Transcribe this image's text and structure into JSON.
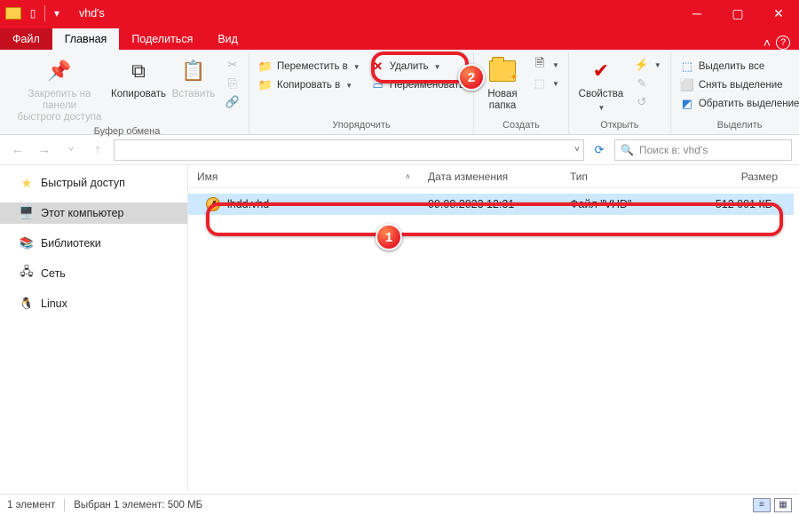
{
  "window": {
    "title": "vhd's"
  },
  "tabs": {
    "file": "Файл",
    "home": "Главная",
    "share": "Поделиться",
    "view": "Вид"
  },
  "ribbon": {
    "clipboard": {
      "label": "Буфер обмена",
      "pin": "Закрепить на панели\nбыстрого доступа",
      "copy": "Копировать",
      "paste": "Вставить"
    },
    "organize": {
      "label": "Упорядочить",
      "move_to": "Переместить в",
      "copy_to": "Копировать в",
      "delete": "Удалить",
      "rename": "Переименовать"
    },
    "new": {
      "label": "Создать",
      "new_folder": "Новая\nпапка"
    },
    "open": {
      "label": "Открыть",
      "properties": "Свойства"
    },
    "select": {
      "label": "Выделить",
      "select_all": "Выделить все",
      "select_none": "Снять выделение",
      "invert": "Обратить выделение"
    }
  },
  "address": {
    "search_placeholder": "Поиск в: vhd's"
  },
  "nav": {
    "quick": "Быстрый доступ",
    "thispc": "Этот компьютер",
    "libraries": "Библиотеки",
    "network": "Сеть",
    "linux": "Linux"
  },
  "columns": {
    "name": "Имя",
    "date": "Дата изменения",
    "type": "Тип",
    "size": "Размер"
  },
  "files": [
    {
      "name": "lhdd.vhd",
      "date": "09.08.2023 12:31",
      "type": "Файл \"VHD\"",
      "size": "512 001 КБ"
    }
  ],
  "status": {
    "count": "1 элемент",
    "selection": "Выбран 1 элемент: 500 МБ"
  },
  "callouts": {
    "one": "1",
    "two": "2"
  }
}
